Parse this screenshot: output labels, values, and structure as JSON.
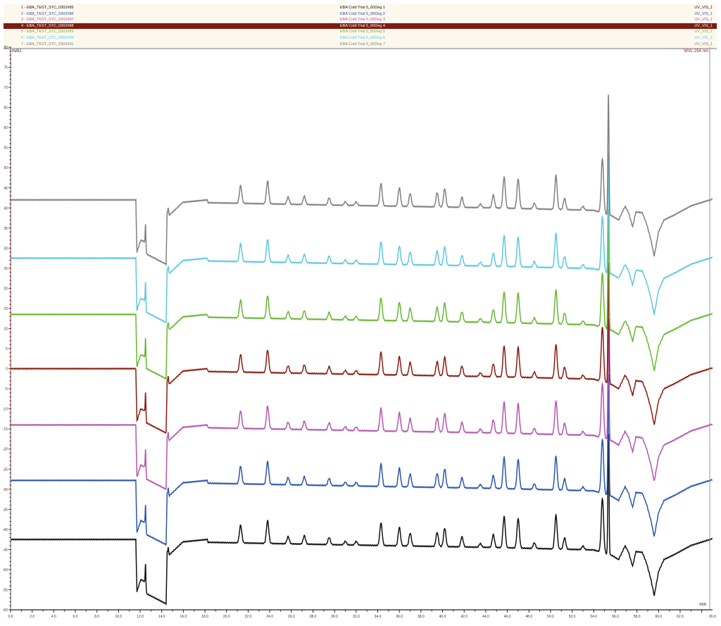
{
  "legend": {
    "rows": [
      {
        "index": "1",
        "sample": "1 - EBA_TEST_STC_0302#85",
        "method": "EBA Cold Trial 5_60Deg 1",
        "channel": "UV_VIS_1",
        "color": "#111111",
        "selected": false
      },
      {
        "index": "2",
        "sample": "2 - EBA_TEST_STC_0302#86",
        "method": "EBA Cold Trial 5_60Deg 2",
        "channel": "UV_VIS_1",
        "color": "#2a55b0",
        "selected": false
      },
      {
        "index": "3",
        "sample": "3 - EBA_TEST_STC_0302#87",
        "method": "EBA Cold Trial 5_60Deg 3",
        "channel": "UV_VIS_1",
        "color": "#b455b0",
        "selected": false
      },
      {
        "index": "4",
        "sample": "4 - EBA_TEST_STC_0302#88",
        "method": "EBA Cold Trial 5_60Deg 4",
        "channel": "UV_VIS_1",
        "color": "#8b1a10",
        "selected": true
      },
      {
        "index": "5",
        "sample": "5 - EBA_TEST_STC_0302#89",
        "method": "EBA Cold Trial 5_60Deg 5",
        "channel": "UV_VIS_1",
        "color": "#66b82e",
        "selected": false
      },
      {
        "index": "6",
        "sample": "6 - EBA_TEST_STC_0302#90",
        "method": "EBA Cold Trial 5_60Deg 6",
        "channel": "UV_VIS_1",
        "color": "#5bc8e0",
        "selected": false
      },
      {
        "index": "7",
        "sample": "7 - EBA_TEST_STC_0302#91",
        "method": "EBA Cold Trial 5_60Deg 7",
        "channel": "UV_VIS_1",
        "color": "#808080",
        "selected": false
      }
    ]
  },
  "chart_data": {
    "type": "line",
    "title": "",
    "ylabel": "mAU",
    "xlabel": "min",
    "wavelength_label": "WVL:254 nm",
    "xlim": [
      0,
      65
    ],
    "ylim": [
      -60,
      80
    ],
    "x_ticks": [
      "0.0",
      "2.0",
      "4.0",
      "6.0",
      "8.0",
      "10.0",
      "12.0",
      "14.0",
      "16.0",
      "18.0",
      "20.0",
      "22.0",
      "24.0",
      "26.0",
      "28.0",
      "30.0",
      "32.0",
      "34.0",
      "36.0",
      "38.0",
      "40.0",
      "42.0",
      "44.0",
      "46.0",
      "48.0",
      "50.0",
      "52.0",
      "54.0",
      "56.0",
      "58.0",
      "60.0",
      "62.0",
      "65.0"
    ],
    "y_ticks": [
      "80",
      "75",
      "70",
      "65",
      "60",
      "55",
      "50",
      "45",
      "40",
      "35",
      "30",
      "25",
      "20",
      "15",
      "10",
      "5",
      "0",
      "-5",
      "-10",
      "-15",
      "-20",
      "-25",
      "-30",
      "-35",
      "-40",
      "-45",
      "-50",
      "-55",
      "-60"
    ],
    "grid": false,
    "profile_baseline": [
      [
        0,
        0
      ],
      [
        11.6,
        0
      ],
      [
        11.7,
        -13
      ],
      [
        12.05,
        -10
      ],
      [
        12.45,
        -10.5
      ],
      [
        12.6,
        -13.5
      ],
      [
        14.4,
        -16
      ],
      [
        14.5,
        -3
      ],
      [
        14.7,
        -3.8
      ],
      [
        15.96,
        -0.6
      ],
      [
        18.2,
        0
      ],
      [
        18.3,
        -0.7
      ],
      [
        30,
        -1.3
      ],
      [
        45,
        -2
      ],
      [
        54,
        -2.6
      ],
      [
        55.7,
        -4
      ],
      [
        56.3,
        -5
      ],
      [
        56.9,
        -1.6
      ],
      [
        57.2,
        -3
      ],
      [
        57.6,
        -6.7
      ],
      [
        57.9,
        -3
      ],
      [
        58.5,
        -3.2
      ],
      [
        58.9,
        -6
      ],
      [
        59.3,
        -10
      ],
      [
        59.6,
        -14
      ],
      [
        60.0,
        -8
      ],
      [
        60.5,
        -5
      ],
      [
        61.5,
        -3.7
      ],
      [
        63,
        -1.5
      ],
      [
        65,
        0.2
      ]
    ],
    "peaks": [
      {
        "rt": 12.5,
        "height": 5.5
      },
      {
        "rt": 14.6,
        "height": 1.5
      },
      {
        "rt": 21.3,
        "height": 4.4
      },
      {
        "rt": 23.8,
        "height": 5.6
      },
      {
        "rt": 25.7,
        "height": 1.8
      },
      {
        "rt": 27.2,
        "height": 2.1
      },
      {
        "rt": 29.5,
        "height": 1.8
      },
      {
        "rt": 31.0,
        "height": 0.9
      },
      {
        "rt": 32.0,
        "height": 0.9
      },
      {
        "rt": 34.3,
        "height": 5.6
      },
      {
        "rt": 36.0,
        "height": 4.6
      },
      {
        "rt": 37.0,
        "height": 3.2
      },
      {
        "rt": 39.5,
        "height": 3.5
      },
      {
        "rt": 40.2,
        "height": 4.6
      },
      {
        "rt": 41.8,
        "height": 2.5
      },
      {
        "rt": 43.5,
        "height": 0.9
      },
      {
        "rt": 44.7,
        "height": 3.2
      },
      {
        "rt": 45.7,
        "height": 7.7
      },
      {
        "rt": 47.0,
        "height": 7.4
      },
      {
        "rt": 48.5,
        "height": 1.4
      },
      {
        "rt": 50.5,
        "height": 8.4
      },
      {
        "rt": 51.3,
        "height": 2.8
      },
      {
        "rt": 53.0,
        "height": 0.9
      },
      {
        "rt": 54.8,
        "height": 13.5
      },
      {
        "rt": 55.36,
        "height": 30
      }
    ],
    "series": [
      {
        "name": "1 - EBA_TEST_STC_0302#85",
        "offset": -42.5,
        "color": "#111111"
      },
      {
        "name": "2 - EBA_TEST_STC_0302#86",
        "offset": -27.8,
        "color": "#2a55b0"
      },
      {
        "name": "3 - EBA_TEST_STC_0302#87",
        "offset": -14,
        "color": "#b455b0"
      },
      {
        "name": "4 - EBA_TEST_STC_0302#88",
        "offset": 0,
        "color": "#8b1a10"
      },
      {
        "name": "5 - EBA_TEST_STC_0302#89",
        "offset": 13.5,
        "color": "#66b82e"
      },
      {
        "name": "6 - EBA_TEST_STC_0302#90",
        "offset": 27.5,
        "color": "#5bc8e0"
      },
      {
        "name": "7 - EBA_TEST_STC_0302#91",
        "offset": 42,
        "color": "#808080"
      }
    ]
  }
}
